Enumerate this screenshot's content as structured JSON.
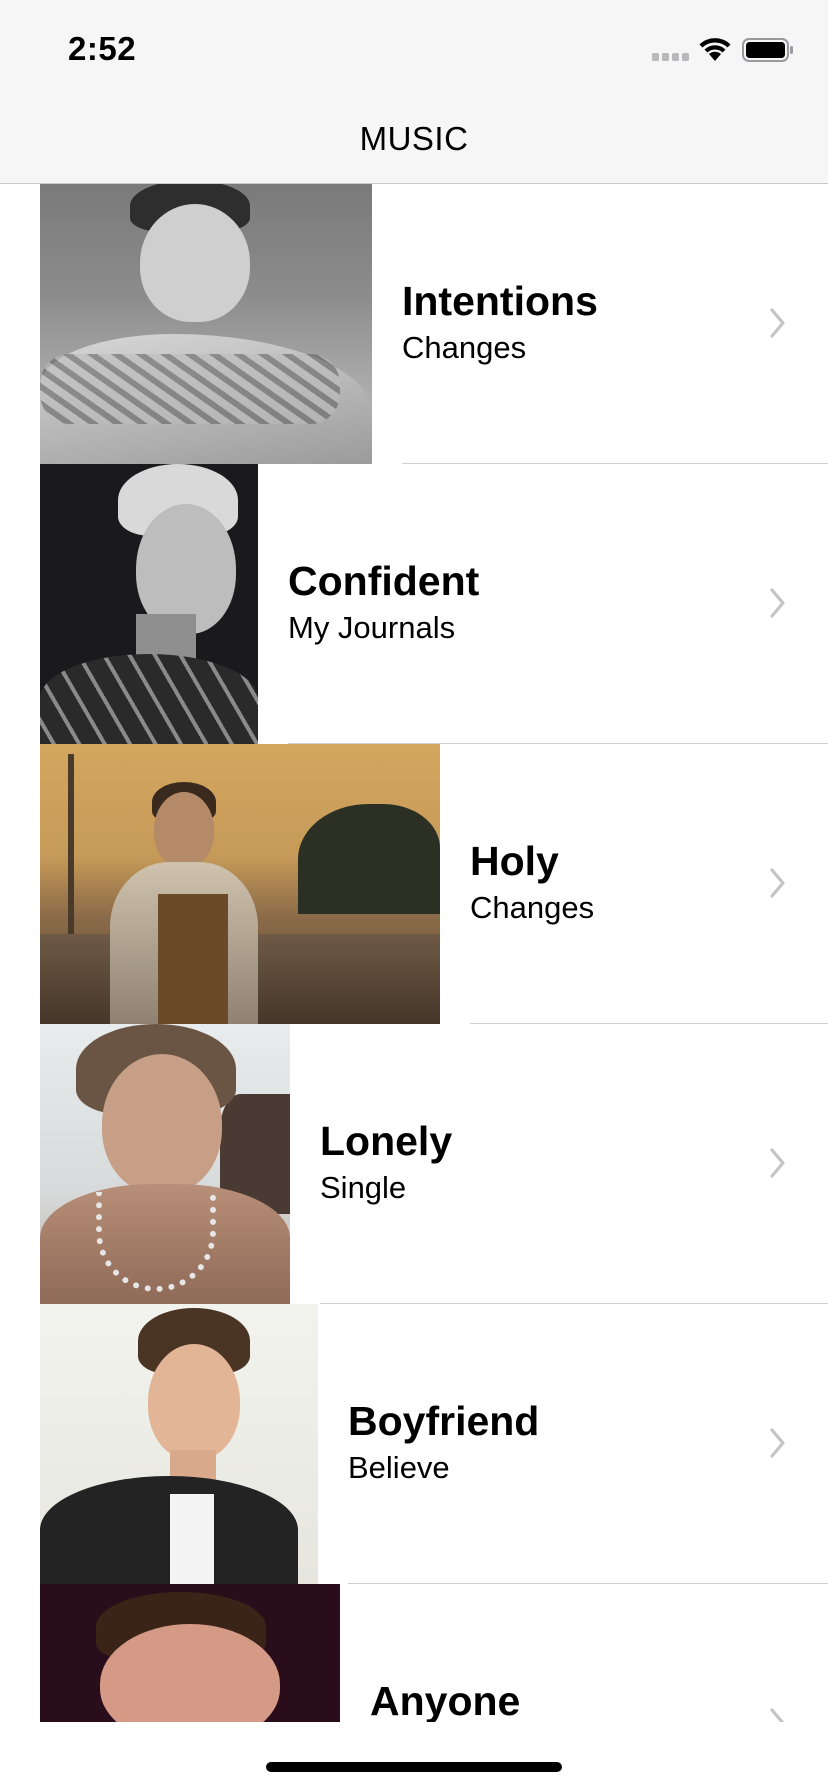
{
  "status_bar": {
    "time": "2:52"
  },
  "nav": {
    "title": "MUSIC"
  },
  "songs": [
    {
      "title": "Intentions",
      "album": "Changes"
    },
    {
      "title": "Confident",
      "album": "My Journals"
    },
    {
      "title": "Holy",
      "album": "Changes"
    },
    {
      "title": "Lonely",
      "album": "Single"
    },
    {
      "title": "Boyfriend",
      "album": "Believe"
    },
    {
      "title": "Anyone",
      "album": ""
    }
  ],
  "colors": {
    "nav_background": "#f6f6f6",
    "separator": "#d0d0d4",
    "chevron": "#c4c4c7",
    "text": "#000000"
  },
  "icons": {
    "signal": "cellular-signal-icon",
    "wifi": "wifi-icon",
    "battery": "battery-icon",
    "row_accessory": "chevron-right-icon"
  }
}
